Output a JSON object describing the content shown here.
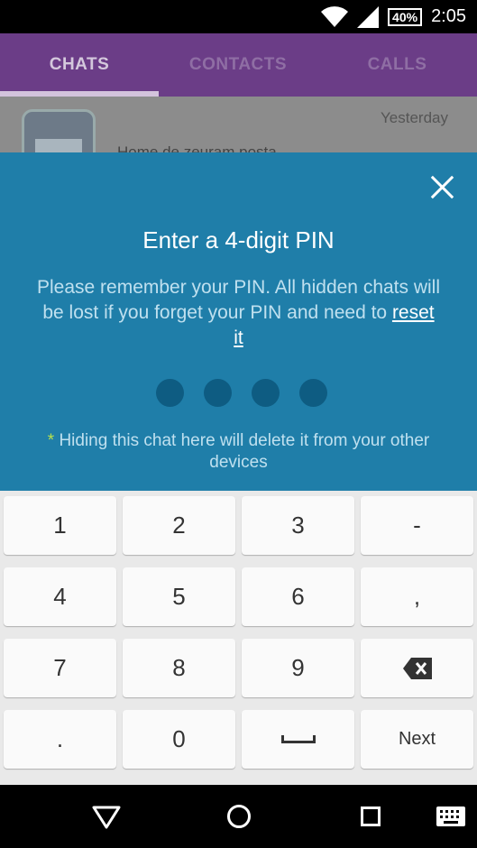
{
  "status_bar": {
    "battery": "40%",
    "time": "2:05"
  },
  "tabs": [
    {
      "label": "CHATS",
      "active": true
    },
    {
      "label": "CONTACTS",
      "active": false
    },
    {
      "label": "CALLS",
      "active": false
    }
  ],
  "chat_preview": {
    "time": "Yesterday",
    "text": "Home de zeuram posta"
  },
  "pin_dialog": {
    "title": "Enter a 4-digit PIN",
    "description": "Please remember your PIN. All hidden chats will be lost if you forget your PIN and need to",
    "reset_link": "reset it",
    "warning_star": "*",
    "warning": "Hiding this chat here will delete it from your other devices",
    "pin_length": 4,
    "pin_entered": 0
  },
  "keyboard": {
    "keys": [
      [
        "1",
        "2",
        "3",
        "-"
      ],
      [
        "4",
        "5",
        "6",
        ","
      ],
      [
        "7",
        "8",
        "9",
        "backspace-icon"
      ],
      [
        ".",
        "0",
        "space-icon",
        "Next"
      ]
    ]
  },
  "colors": {
    "tab_bar": "#6b3d87",
    "pin_panel": "#1f7ea9",
    "pin_dot": "#0e5c82",
    "warning_star": "#b6e04c"
  }
}
